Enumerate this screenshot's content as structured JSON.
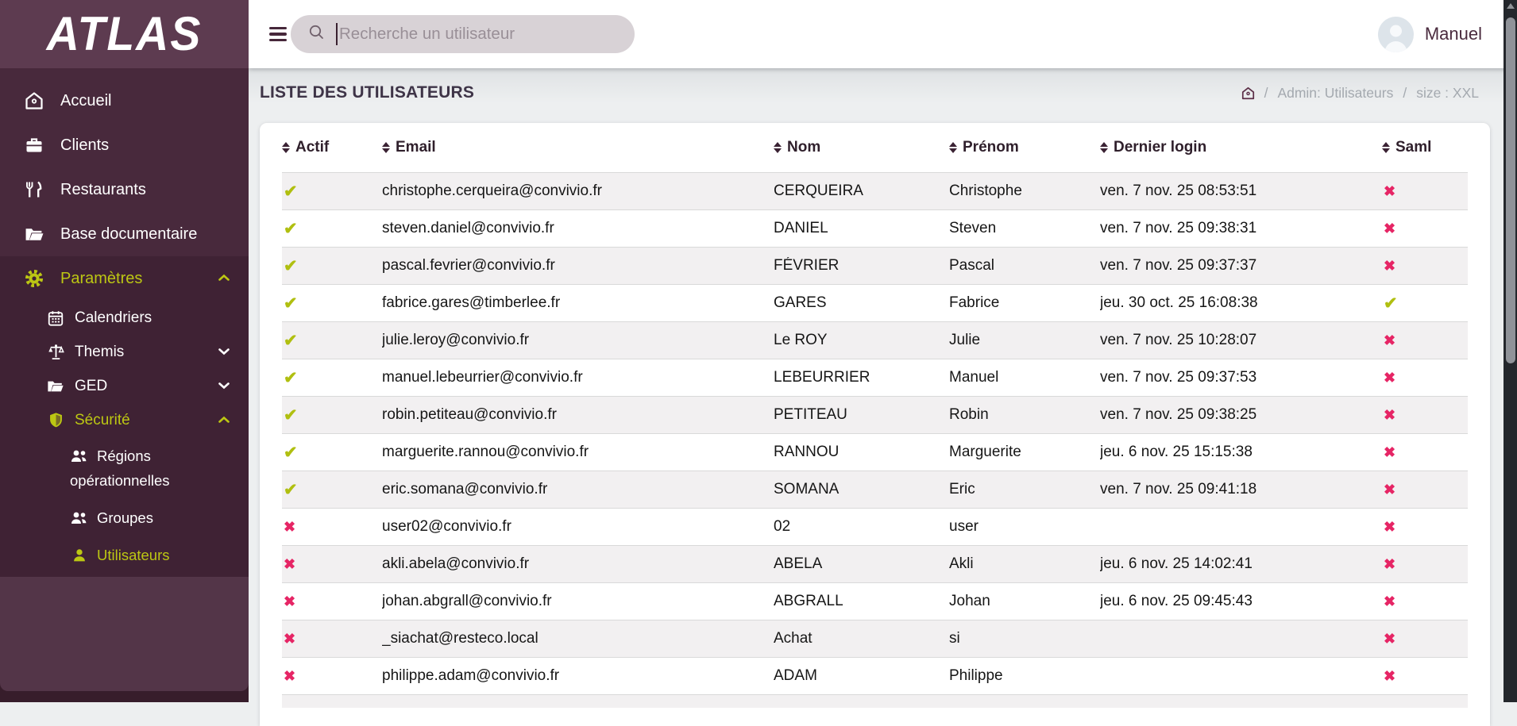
{
  "brand": {
    "logo": "ATLAS"
  },
  "colors": {
    "sidebar": "#48293c",
    "sidebar_dark": "#3f2234",
    "accent": "#bcc713",
    "check": "#b0bf10",
    "cross": "#e62565",
    "topbar": "#ffffff",
    "page_bg": "#edeff0"
  },
  "topbar": {
    "search_placeholder": "Recherche un utilisateur",
    "user_name": "Manuel"
  },
  "breadcrumb": {
    "title": "LISTE DES UTILISATEURS",
    "home_icon": "home-icon",
    "items": [
      "Admin: Utilisateurs",
      "size : XXL"
    ],
    "separator": "/"
  },
  "sidebar": {
    "items": [
      {
        "label": "Accueil",
        "icon": "home-icon"
      },
      {
        "label": "Clients",
        "icon": "briefcase-icon"
      },
      {
        "label": "Restaurants",
        "icon": "cutlery-icon"
      },
      {
        "label": "Base documentaire",
        "icon": "folder-open-icon"
      },
      {
        "label": "Paramètres",
        "icon": "gear-icon",
        "state": "expanded-active"
      },
      {
        "label": "Calendriers",
        "icon": "calendar-icon"
      },
      {
        "label": "Themis",
        "icon": "scales-icon",
        "state": "collapsed"
      },
      {
        "label": "GED",
        "icon": "folder-open-icon",
        "state": "collapsed"
      },
      {
        "label": "Sécurité",
        "icon": "shield-icon",
        "state": "expanded-active"
      },
      {
        "label": "Régions opérationnelles",
        "icon": "users-icon"
      },
      {
        "label": "Groupes",
        "icon": "users-icon"
      },
      {
        "label": "Utilisateurs",
        "icon": "user-icon",
        "state": "active"
      }
    ]
  },
  "table": {
    "headers": [
      "Actif",
      "Email",
      "Nom",
      "Prénom",
      "Dernier login",
      "Saml"
    ],
    "check_glyph": "✔",
    "cross_glyph": "✖",
    "rows": [
      {
        "actif": true,
        "email": "christophe.cerqueira@convivio.fr",
        "nom": "CERQUEIRA",
        "prenom": "Christophe",
        "dernier_login": "ven. 7 nov. 25 08:53:51",
        "saml": false
      },
      {
        "actif": true,
        "email": "steven.daniel@convivio.fr",
        "nom": "DANIEL",
        "prenom": "Steven",
        "dernier_login": "ven. 7 nov. 25 09:38:31",
        "saml": false
      },
      {
        "actif": true,
        "email": "pascal.fevrier@convivio.fr",
        "nom": "FÉVRIER",
        "prenom": "Pascal",
        "dernier_login": "ven. 7 nov. 25 09:37:37",
        "saml": false
      },
      {
        "actif": true,
        "email": "fabrice.gares@timberlee.fr",
        "nom": "GARES",
        "prenom": "Fabrice",
        "dernier_login": "jeu. 30 oct. 25 16:08:38",
        "saml": true
      },
      {
        "actif": true,
        "email": "julie.leroy@convivio.fr",
        "nom": "Le ROY",
        "prenom": "Julie",
        "dernier_login": "ven. 7 nov. 25 10:28:07",
        "saml": false
      },
      {
        "actif": true,
        "email": "manuel.lebeurrier@convivio.fr",
        "nom": "LEBEURRIER",
        "prenom": "Manuel",
        "dernier_login": "ven. 7 nov. 25 09:37:53",
        "saml": false
      },
      {
        "actif": true,
        "email": "robin.petiteau@convivio.fr",
        "nom": "PETITEAU",
        "prenom": "Robin",
        "dernier_login": "ven. 7 nov. 25 09:38:25",
        "saml": false
      },
      {
        "actif": true,
        "email": "marguerite.rannou@convivio.fr",
        "nom": "RANNOU",
        "prenom": "Marguerite",
        "dernier_login": "jeu. 6 nov. 25 15:15:38",
        "saml": false
      },
      {
        "actif": true,
        "email": "eric.somana@convivio.fr",
        "nom": "SOMANA",
        "prenom": "Eric",
        "dernier_login": "ven. 7 nov. 25 09:41:18",
        "saml": false
      },
      {
        "actif": false,
        "email": "user02@convivio.fr",
        "nom": "02",
        "prenom": "user",
        "dernier_login": "",
        "saml": false
      },
      {
        "actif": false,
        "email": "akli.abela@convivio.fr",
        "nom": "ABELA",
        "prenom": "Akli",
        "dernier_login": "jeu. 6 nov. 25 14:02:41",
        "saml": false
      },
      {
        "actif": false,
        "email": "johan.abgrall@convivio.fr",
        "nom": "ABGRALL",
        "prenom": "Johan",
        "dernier_login": "jeu. 6 nov. 25 09:45:43",
        "saml": false
      },
      {
        "actif": false,
        "email": "_siachat@resteco.local",
        "nom": "Achat",
        "prenom": "si",
        "dernier_login": "",
        "saml": false
      },
      {
        "actif": false,
        "email": "philippe.adam@convivio.fr",
        "nom": "ADAM",
        "prenom": "Philippe",
        "dernier_login": "",
        "saml": false
      }
    ]
  }
}
